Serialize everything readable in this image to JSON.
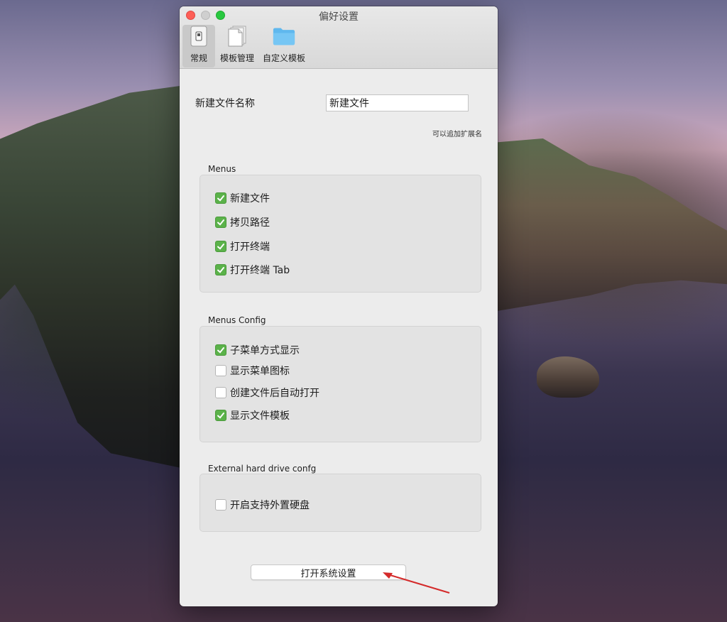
{
  "window": {
    "title": "偏好设置"
  },
  "toolbar": {
    "items": [
      {
        "label": "常规",
        "icon": "toggle-switch-icon",
        "active": true
      },
      {
        "label": "模板管理",
        "icon": "documents-icon",
        "active": false
      },
      {
        "label": "自定义模板",
        "icon": "folder-icon",
        "active": false
      }
    ]
  },
  "general": {
    "new_file_name_label": "新建文件名称",
    "new_file_name_value": "新建文件",
    "extension_hint": "可以追加扩展名"
  },
  "menus": {
    "title": "Menus",
    "items": [
      {
        "label": "新建文件",
        "checked": true
      },
      {
        "label": "拷贝路径",
        "checked": true
      },
      {
        "label": "打开终端",
        "checked": true
      },
      {
        "label": "打开终端 Tab",
        "checked": true
      }
    ]
  },
  "menus_config": {
    "title": "Menus Config",
    "items": [
      {
        "label": "子菜单方式显示",
        "checked": true
      },
      {
        "label": "显示菜单图标",
        "checked": false
      },
      {
        "label": "创建文件后自动打开",
        "checked": false
      },
      {
        "label": "显示文件模板",
        "checked": true
      }
    ]
  },
  "external_drive": {
    "title": "External hard drive confg",
    "items": [
      {
        "label": "开启支持外置硬盘",
        "checked": false
      }
    ]
  },
  "actions": {
    "open_system_settings": "打开系统设置"
  },
  "colors": {
    "checkbox_checked": "#5bb24a",
    "close": "#fd5f57",
    "zoom": "#29c840",
    "annotation_arrow": "#d42a2a"
  }
}
